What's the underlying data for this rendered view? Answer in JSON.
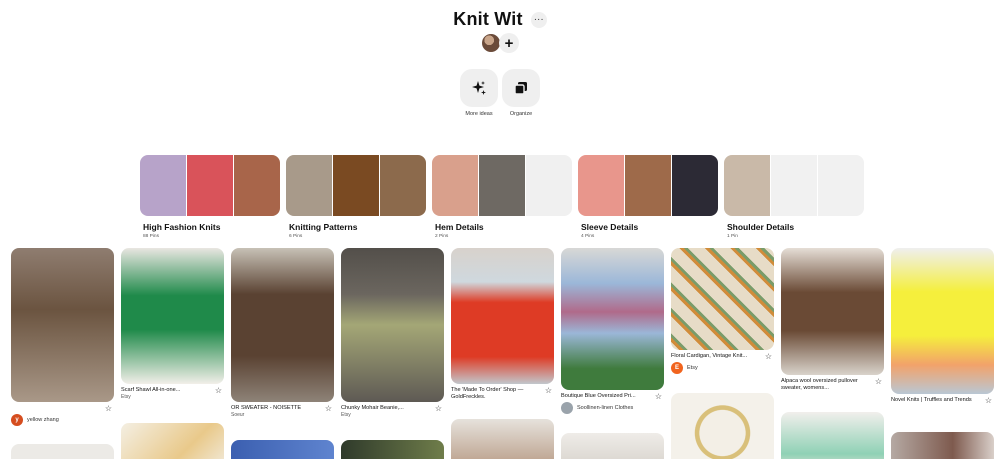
{
  "board": {
    "title": "Knit Wit",
    "more_label": "···",
    "add_collaborator": "+",
    "actions": [
      {
        "label": "More ideas",
        "icon": "sparkle-icon"
      },
      {
        "label": "Organize",
        "icon": "organize-icon"
      }
    ]
  },
  "sections": [
    {
      "name": "High Fashion Knits",
      "count": "88 Pins",
      "colors": [
        "#b7a3c9",
        "#d9535a",
        "#a8654a"
      ]
    },
    {
      "name": "Knitting Patterns",
      "count": "6 Pins",
      "colors": [
        "#a89a8a",
        "#7a4a22",
        "#8c6a4c"
      ]
    },
    {
      "name": "Hem Details",
      "count": "2 Pins",
      "colors": [
        "#d9a08c",
        "#6e6963",
        "#f0f0f0"
      ]
    },
    {
      "name": "Sleeve Details",
      "count": "4 Pins",
      "colors": [
        "#e8968c",
        "#9e6a4a",
        "#2c2a35"
      ]
    },
    {
      "name": "Shoulder Details",
      "count": "1 Pin",
      "colors": [
        "#c9b9a8",
        "#f1f1f1",
        "#f1f1f1"
      ]
    }
  ],
  "pins": [
    {
      "title": "",
      "source": "",
      "user": "yellow zhang",
      "user_initial": "y",
      "user_color": "#d54d1f",
      "colors": [
        "#6b5440",
        "#8f7d70"
      ]
    },
    {
      "title": "Scarf Shawl All-in-one...",
      "source": "Etsy",
      "user": "",
      "colors": [
        "#1f8a4a",
        "#e9e6e1"
      ]
    },
    {
      "title": "OR SWEATER - NOISETTE",
      "source": "Soeur",
      "user": "",
      "colors": [
        "#5a4232",
        "#c7c1b6"
      ]
    },
    {
      "title": "Chunky Mohair Beanie,...",
      "source": "Etsy",
      "user": "",
      "colors": [
        "#a4a776",
        "#534f4a"
      ]
    },
    {
      "title": "The 'Made To Order' Shop — GoldFreckles.",
      "source": "",
      "user": "",
      "colors": [
        "#de3b25",
        "#cfd8de"
      ]
    },
    {
      "title": "Boutique Blue Oversized Pri...",
      "source": "",
      "user": "Soollinen-linen Clothes",
      "user_initial": "",
      "user_color": "#9aa3ab",
      "colors": [
        "#9bb7d8",
        "#3f7b3d"
      ]
    },
    {
      "title": "Floral Cardigan, Vintage Knit...",
      "source": "",
      "user": "Etsy",
      "user_initial": "E",
      "user_color": "#f1641e",
      "colors": [
        "#e7dcc7",
        "#d18c3a"
      ]
    },
    {
      "title": "Alpaca wool oversized pullover sweater, womens...",
      "source": "",
      "user": "",
      "colors": [
        "#6a4a35",
        "#d9d3cb"
      ]
    },
    {
      "title": "Novel Knits | Truffles and Trends",
      "source": "",
      "user": "",
      "colors": [
        "#f5ef3c",
        "#f2a26a"
      ]
    }
  ]
}
